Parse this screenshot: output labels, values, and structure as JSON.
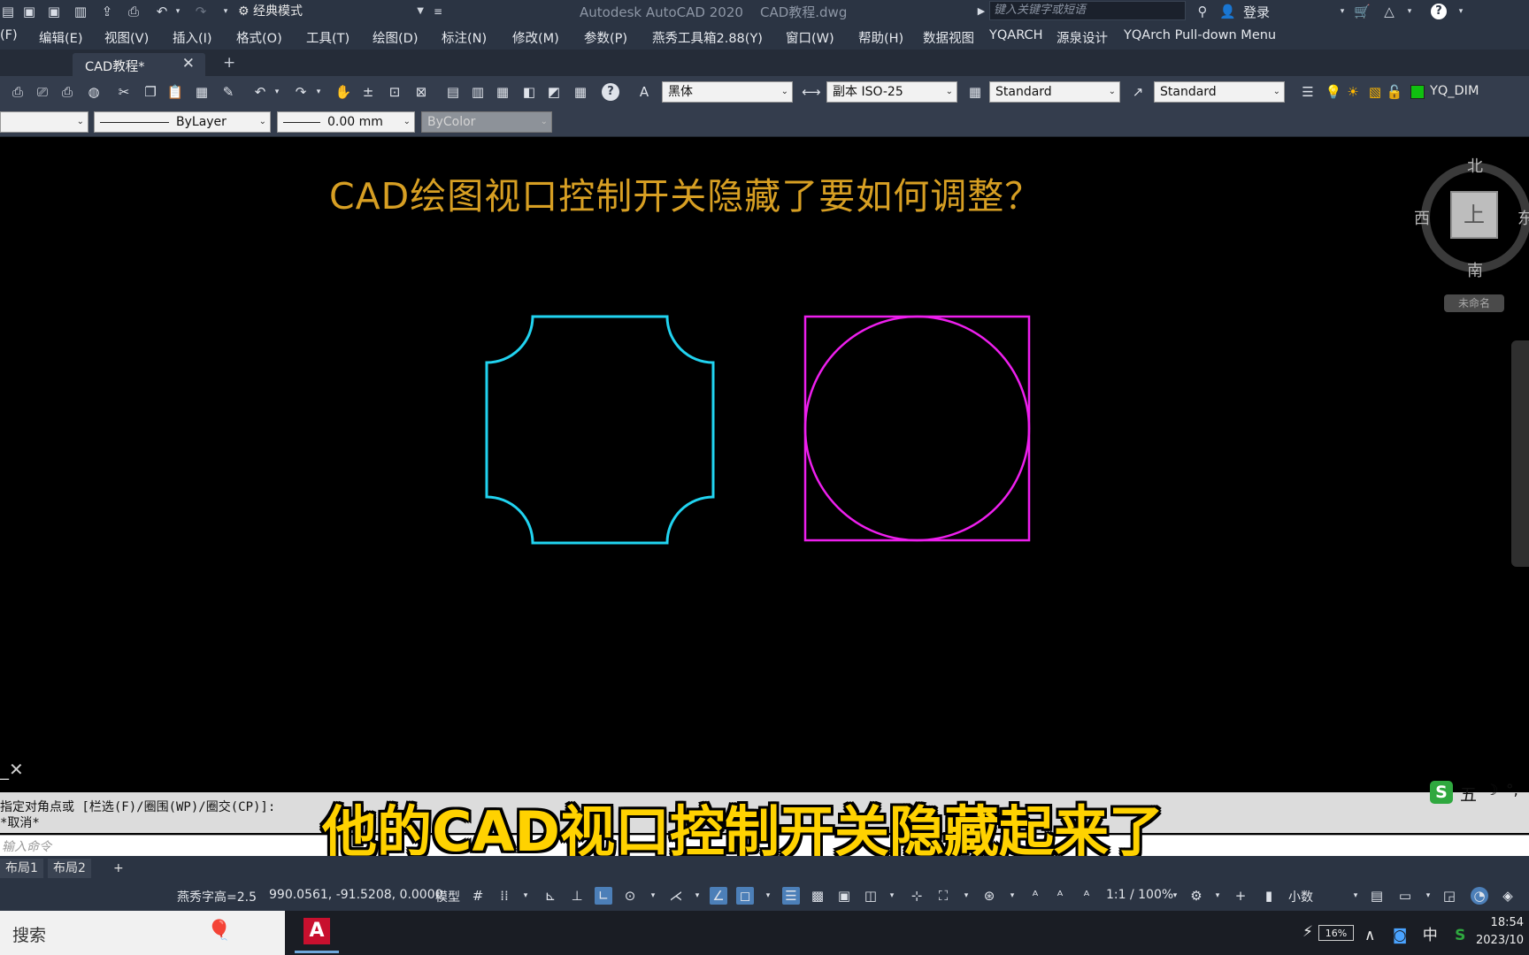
{
  "titlebar": {
    "workspace": "经典模式",
    "app_title": "Autodesk AutoCAD 2020    CAD教程.dwg",
    "search_placeholder": "键入关键字或短语",
    "login": "登录"
  },
  "menu": [
    "(F)",
    "编辑(E)",
    "视图(V)",
    "插入(I)",
    "格式(O)",
    "工具(T)",
    "绘图(D)",
    "标注(N)",
    "修改(M)",
    "参数(P)",
    "燕秀工具箱2.88(Y)",
    "窗口(W)",
    "帮助(H)",
    "数据视图",
    "YQARCH",
    "源泉设计",
    "YQArch Pull-down Menu"
  ],
  "tabs": {
    "document": "CAD教程*",
    "new_tab": "+"
  },
  "toolbar1": {
    "text_font": "黑体",
    "dim_style": "副本 ISO-25",
    "table_style": "Standard",
    "multileader_style": "Standard",
    "layer": "YQ_DIM",
    "layer_color": "#10c010"
  },
  "toolbar2": {
    "linetype": "ByLayer",
    "lineweight": "0.00 mm",
    "plot_color": "ByColor"
  },
  "drawing": {
    "title": "CAD绘图视口控制开关隐藏了要如何调整？",
    "title_color": "#d79f23",
    "shape1_color": "#21d3f0",
    "shape2_color": "#ee1fee"
  },
  "viewcube": {
    "north": "北",
    "south": "南",
    "west": "西",
    "east": "东",
    "top_face": "上",
    "wcs": "未命名"
  },
  "command": {
    "history_line1": "指定对角点或 [栏选(F)/圈围(WP)/圈交(CP)]:",
    "history_line2": "*取消*",
    "input_placeholder": "输入命令"
  },
  "subtitle": "他的CAD视口控制开关隐藏起来了",
  "ime": {
    "mode": "五"
  },
  "layout_tabs": [
    "布局1",
    "布局2",
    "+"
  ],
  "statusbar": {
    "text_height": "燕秀字高=2.5",
    "coordinates": "990.0561, -91.5208, 0.0000",
    "model": "模型",
    "scale": "1:1 / 100%",
    "units": "小数"
  },
  "taskbar": {
    "search": "搜索",
    "battery": "16%",
    "ime_lang": "中",
    "time": "18:54",
    "date": "2023/10"
  }
}
